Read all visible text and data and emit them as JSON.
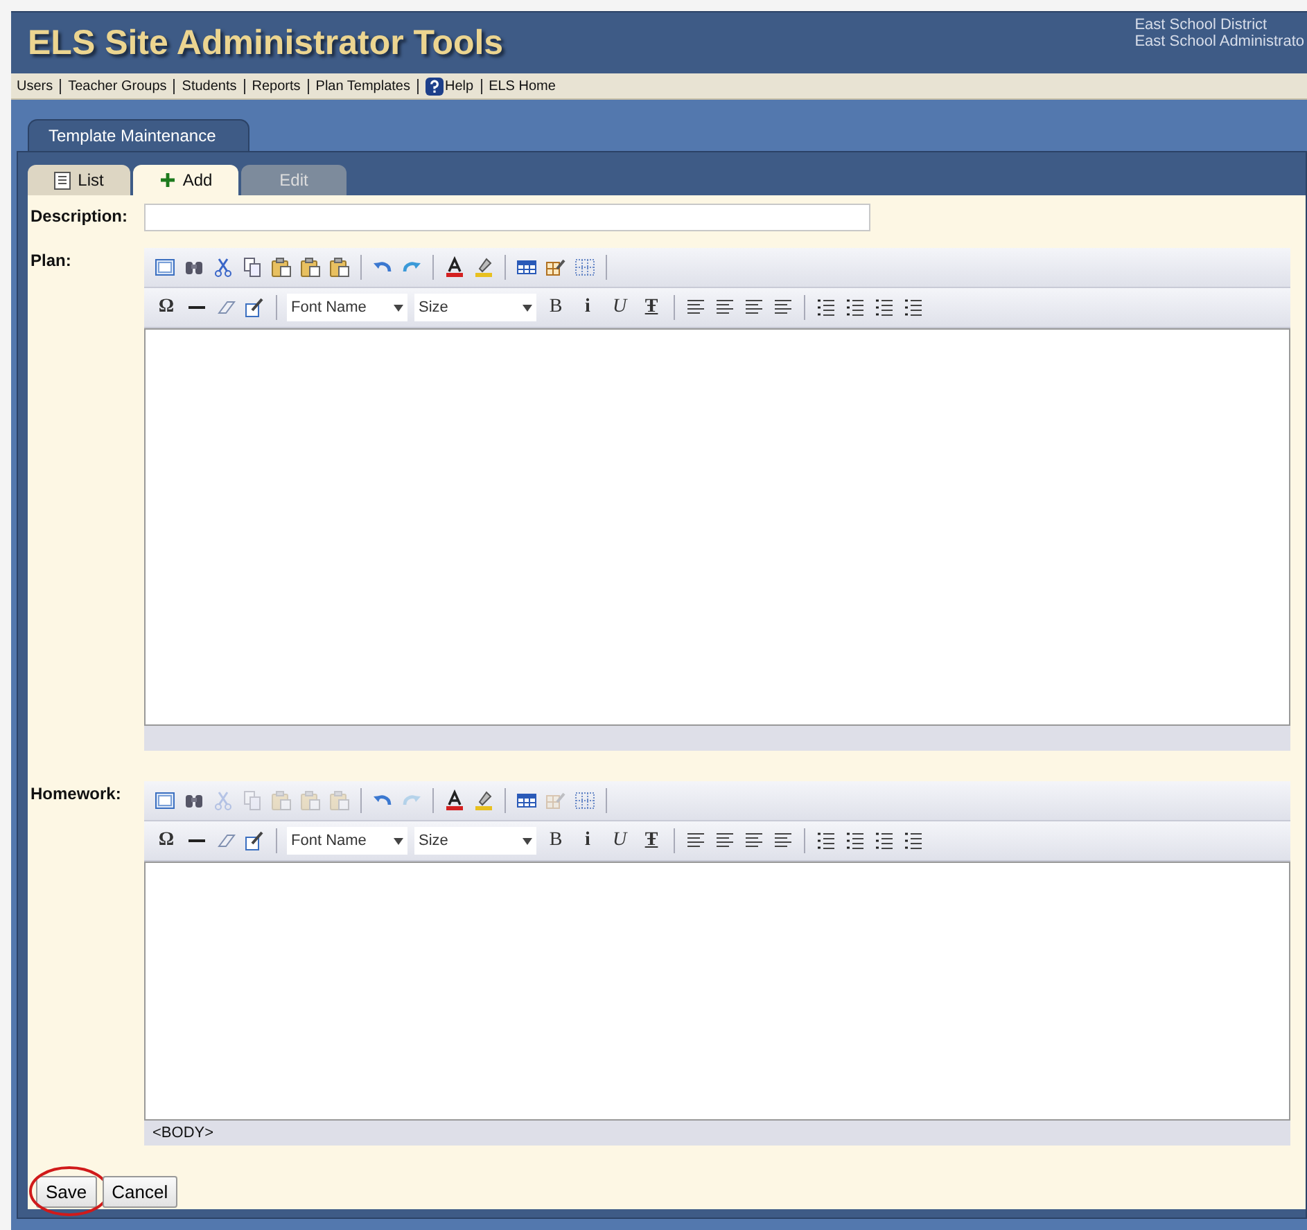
{
  "header": {
    "title": "ELS Site Administrator Tools",
    "district": "East School District",
    "account": "East School Administrato"
  },
  "nav": [
    {
      "label": "Users",
      "kind": "link"
    },
    {
      "label": "Teacher Groups",
      "kind": "link"
    },
    {
      "label": "Students",
      "kind": "link"
    },
    {
      "label": "Reports",
      "kind": "link"
    },
    {
      "label": "Plan Templates",
      "kind": "link"
    },
    {
      "label": "Help",
      "kind": "help"
    },
    {
      "label": "ELS Home",
      "kind": "link"
    }
  ],
  "section_tabs": [
    {
      "label": "Template Maintenance"
    }
  ],
  "tabs": [
    {
      "label": "List",
      "kind": "list",
      "selected": false
    },
    {
      "label": "Add",
      "kind": "add",
      "selected": true
    },
    {
      "label": "Edit",
      "kind": "plain",
      "selected": false
    }
  ],
  "description": {
    "label": "Description:"
  },
  "editors": [
    {
      "label": "Plan:",
      "font_name": "Font Name",
      "size": "Size",
      "toolbar": [
        {
          "kind": "frame",
          "disabled": false
        },
        {
          "kind": "find",
          "disabled": false
        },
        {
          "kind": "cut",
          "disabled": false
        },
        {
          "kind": "copy",
          "disabled": false
        },
        {
          "kind": "paste",
          "disabled": false
        },
        {
          "kind": "paste",
          "disabled": false
        },
        {
          "kind": "paste",
          "disabled": false
        },
        {
          "kind": "sep"
        },
        {
          "kind": "undo",
          "disabled": false
        },
        {
          "kind": "redo",
          "disabled": false
        },
        {
          "kind": "sep"
        },
        {
          "kind": "font-color",
          "disabled": false
        },
        {
          "kind": "highlight",
          "disabled": false
        },
        {
          "kind": "sep"
        },
        {
          "kind": "table",
          "disabled": false
        },
        {
          "kind": "table-edit",
          "disabled": false
        },
        {
          "kind": "grid",
          "disabled": false
        },
        {
          "kind": "sep"
        }
      ],
      "format": [
        {
          "kind": "glyph",
          "glyph": "Ω"
        },
        {
          "kind": "rule"
        },
        {
          "kind": "eraser"
        },
        {
          "kind": "edit"
        },
        {
          "kind": "sep"
        },
        {
          "kind": "font"
        },
        {
          "kind": "size"
        },
        {
          "kind": "glyph",
          "glyph": "B"
        },
        {
          "kind": "glyph",
          "glyph": "i"
        },
        {
          "kind": "glyph",
          "glyph": "U"
        },
        {
          "kind": "glyph",
          "glyph": "Ŧ"
        },
        {
          "kind": "sep"
        },
        {
          "kind": "align"
        },
        {
          "kind": "align"
        },
        {
          "kind": "align"
        },
        {
          "kind": "align"
        },
        {
          "kind": "sep"
        },
        {
          "kind": "list"
        },
        {
          "kind": "list"
        },
        {
          "kind": "list"
        },
        {
          "kind": "list"
        }
      ]
    },
    {
      "label": "Homework:",
      "font_name": "Font Name",
      "size": "Size",
      "status": "<BODY>",
      "toolbar": [
        {
          "kind": "frame",
          "disabled": false
        },
        {
          "kind": "find",
          "disabled": false
        },
        {
          "kind": "cut",
          "disabled": true
        },
        {
          "kind": "copy",
          "disabled": true
        },
        {
          "kind": "paste",
          "disabled": true
        },
        {
          "kind": "paste",
          "disabled": true
        },
        {
          "kind": "paste",
          "disabled": true
        },
        {
          "kind": "sep"
        },
        {
          "kind": "undo",
          "disabled": false
        },
        {
          "kind": "redo",
          "disabled": true
        },
        {
          "kind": "sep"
        },
        {
          "kind": "font-color",
          "disabled": false
        },
        {
          "kind": "highlight",
          "disabled": false
        },
        {
          "kind": "sep"
        },
        {
          "kind": "table",
          "disabled": false
        },
        {
          "kind": "table-edit",
          "disabled": true
        },
        {
          "kind": "grid",
          "disabled": false
        },
        {
          "kind": "sep"
        }
      ],
      "format": [
        {
          "kind": "glyph",
          "glyph": "Ω"
        },
        {
          "kind": "rule"
        },
        {
          "kind": "eraser"
        },
        {
          "kind": "edit"
        },
        {
          "kind": "sep"
        },
        {
          "kind": "font"
        },
        {
          "kind": "size"
        },
        {
          "kind": "glyph",
          "glyph": "B"
        },
        {
          "kind": "glyph",
          "glyph": "i"
        },
        {
          "kind": "glyph",
          "glyph": "U"
        },
        {
          "kind": "glyph",
          "glyph": "Ŧ"
        },
        {
          "kind": "sep"
        },
        {
          "kind": "align"
        },
        {
          "kind": "align"
        },
        {
          "kind": "align"
        },
        {
          "kind": "align"
        },
        {
          "kind": "sep"
        },
        {
          "kind": "list"
        },
        {
          "kind": "list"
        },
        {
          "kind": "list"
        },
        {
          "kind": "list"
        }
      ]
    }
  ],
  "buttons": [
    {
      "label": "Save",
      "circled": true
    },
    {
      "label": "Cancel",
      "circled": false
    }
  ]
}
